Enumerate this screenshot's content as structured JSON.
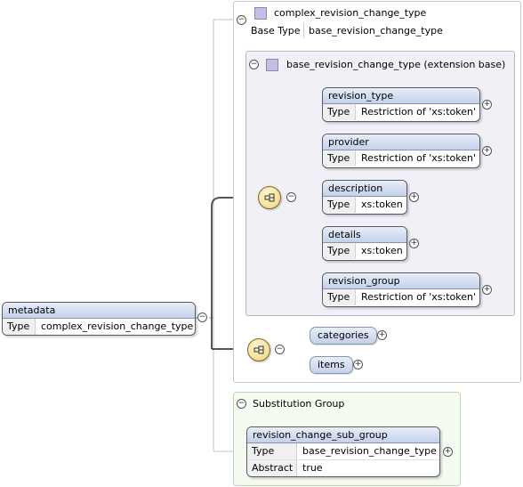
{
  "root": {
    "name": "metadata",
    "type_key": "Type",
    "type_value": "complex_revision_change_type"
  },
  "complex_type": {
    "name": "complex_revision_change_type",
    "base_key": "Base Type",
    "base_value": "base_revision_change_type"
  },
  "extension": {
    "title": "base_revision_change_type (extension base)",
    "elements": [
      {
        "name": "revision_type",
        "type_key": "Type",
        "type_value": "Restriction of 'xs:token'"
      },
      {
        "name": "provider",
        "type_key": "Type",
        "type_value": "Restriction of 'xs:token'"
      },
      {
        "name": "description",
        "type_key": "Type",
        "type_value": "xs:token"
      },
      {
        "name": "details",
        "type_key": "Type",
        "type_value": "xs:token"
      },
      {
        "name": "revision_group",
        "type_key": "Type",
        "type_value": "Restriction of 'xs:token'"
      }
    ]
  },
  "sequence2": {
    "items": [
      "categories",
      "items"
    ]
  },
  "substitution": {
    "title": "Substitution Group",
    "element": {
      "name": "revision_change_sub_group",
      "type_key": "Type",
      "type_value": "base_revision_change_type",
      "abstract_key": "Abstract",
      "abstract_value": "true"
    }
  },
  "colors": {
    "element_header": "#c3d1eb",
    "extension_panel": "#f2f0f7",
    "substitution_panel": "#f5fbf1",
    "sequence_icon": "#ecd27a",
    "complex_type_icon": "#c6bde2"
  },
  "icons": [
    "collapse-icon",
    "expand-icon",
    "sequence-icon",
    "complex-type-icon"
  ]
}
